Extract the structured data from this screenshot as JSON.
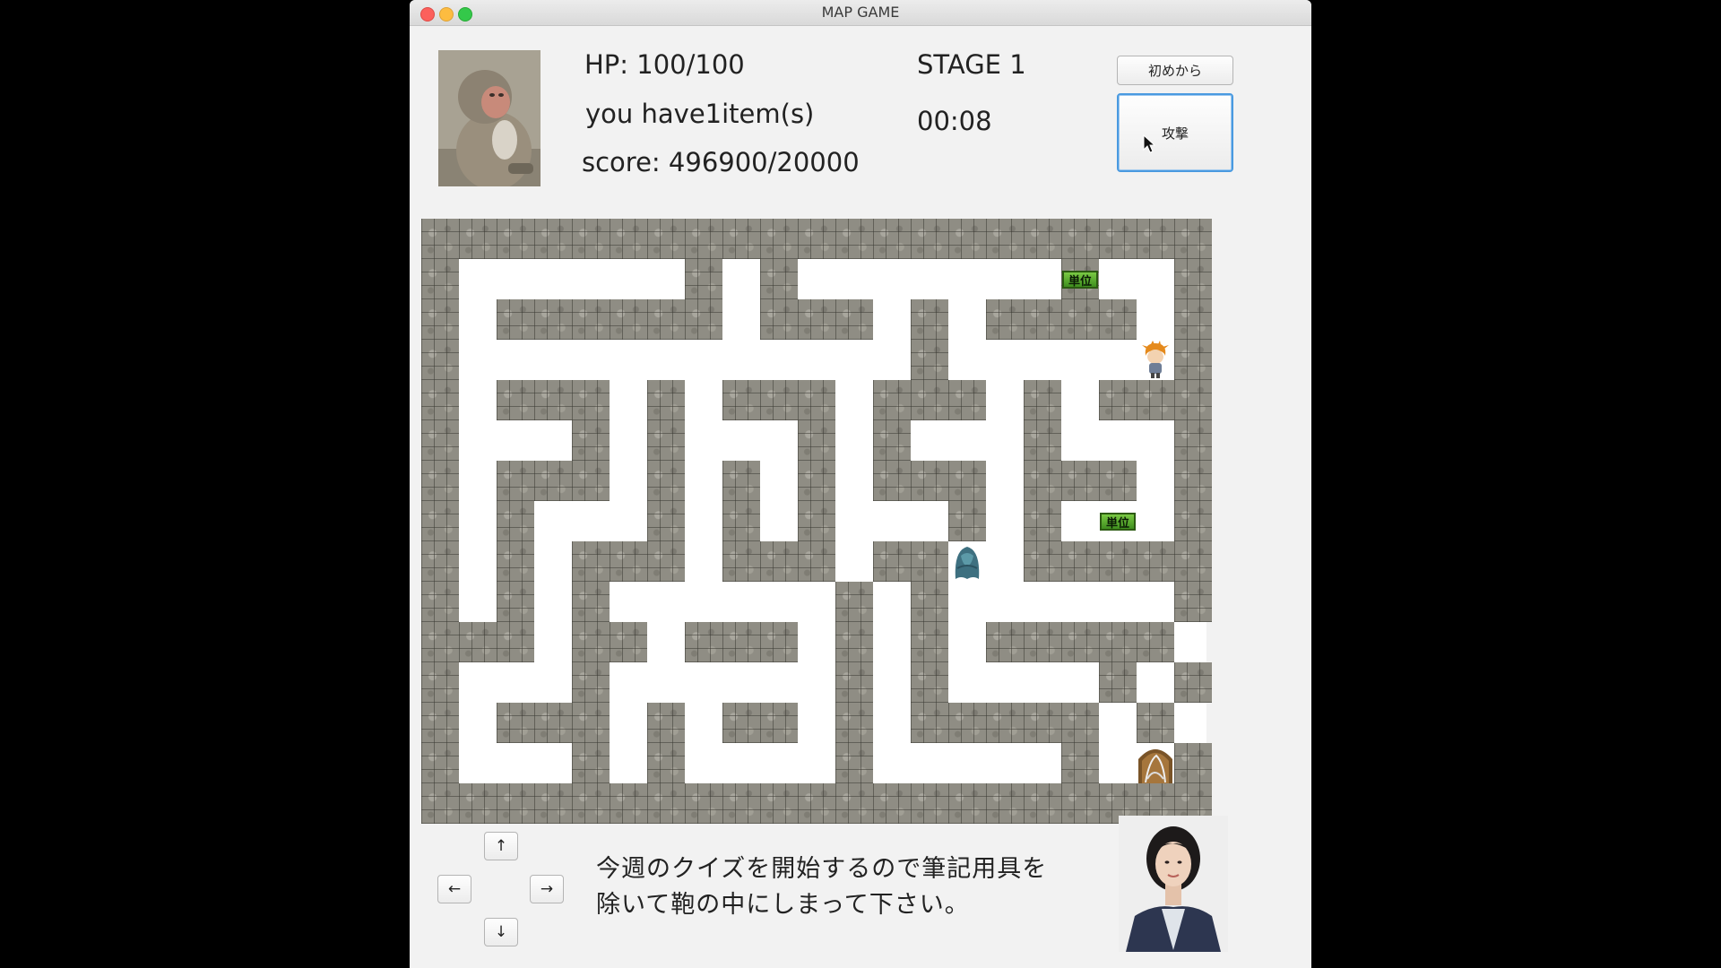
{
  "window": {
    "title": "MAP GAME"
  },
  "stats": {
    "hp": "HP: 100/100",
    "items": "you have1item(s)",
    "score": "score: 496900/20000",
    "stage": "STAGE 1",
    "timer": "00:08"
  },
  "buttons": {
    "restart": "初めから",
    "attack": "攻撃"
  },
  "controls": {
    "up": "↑",
    "left": "←",
    "right": "→",
    "down": "↓"
  },
  "dialog": {
    "line1": "今週のクイズを開始するので筆記用具を",
    "line2": "除いて鞄の中にしまって下さい。"
  },
  "maze": {
    "rows": [
      "#####################",
      "#......#.#.......#..#",
      "#.######.###.#.####.#",
      "#............#.....P#",
      "#.###.#.###.###.#.###",
      "#...#.#...#.#...#...#",
      "#.###.#.#.#.###.###.#",
      "#.#...#.#.#...#.#.I.#",
      "#.#.###.###.##E.#####",
      "#.#.#......#.#......#",
      "###.##.###.#.#.#####.#",
      "#...#......#.#....#.#",
      "#.###.#.##.#.#####.#.#",
      "#...#.#....#.....#.X#",
      "#####################"
    ],
    "legend": {
      "#": "wall",
      ".": "floor",
      "P": "player",
      "E": "enemy",
      "I": "credit-item",
      "X": "exit"
    },
    "items": [
      {
        "label": "単位",
        "row": 1,
        "col": 17
      },
      {
        "label": "単位",
        "row": 7,
        "col": 18
      }
    ]
  }
}
